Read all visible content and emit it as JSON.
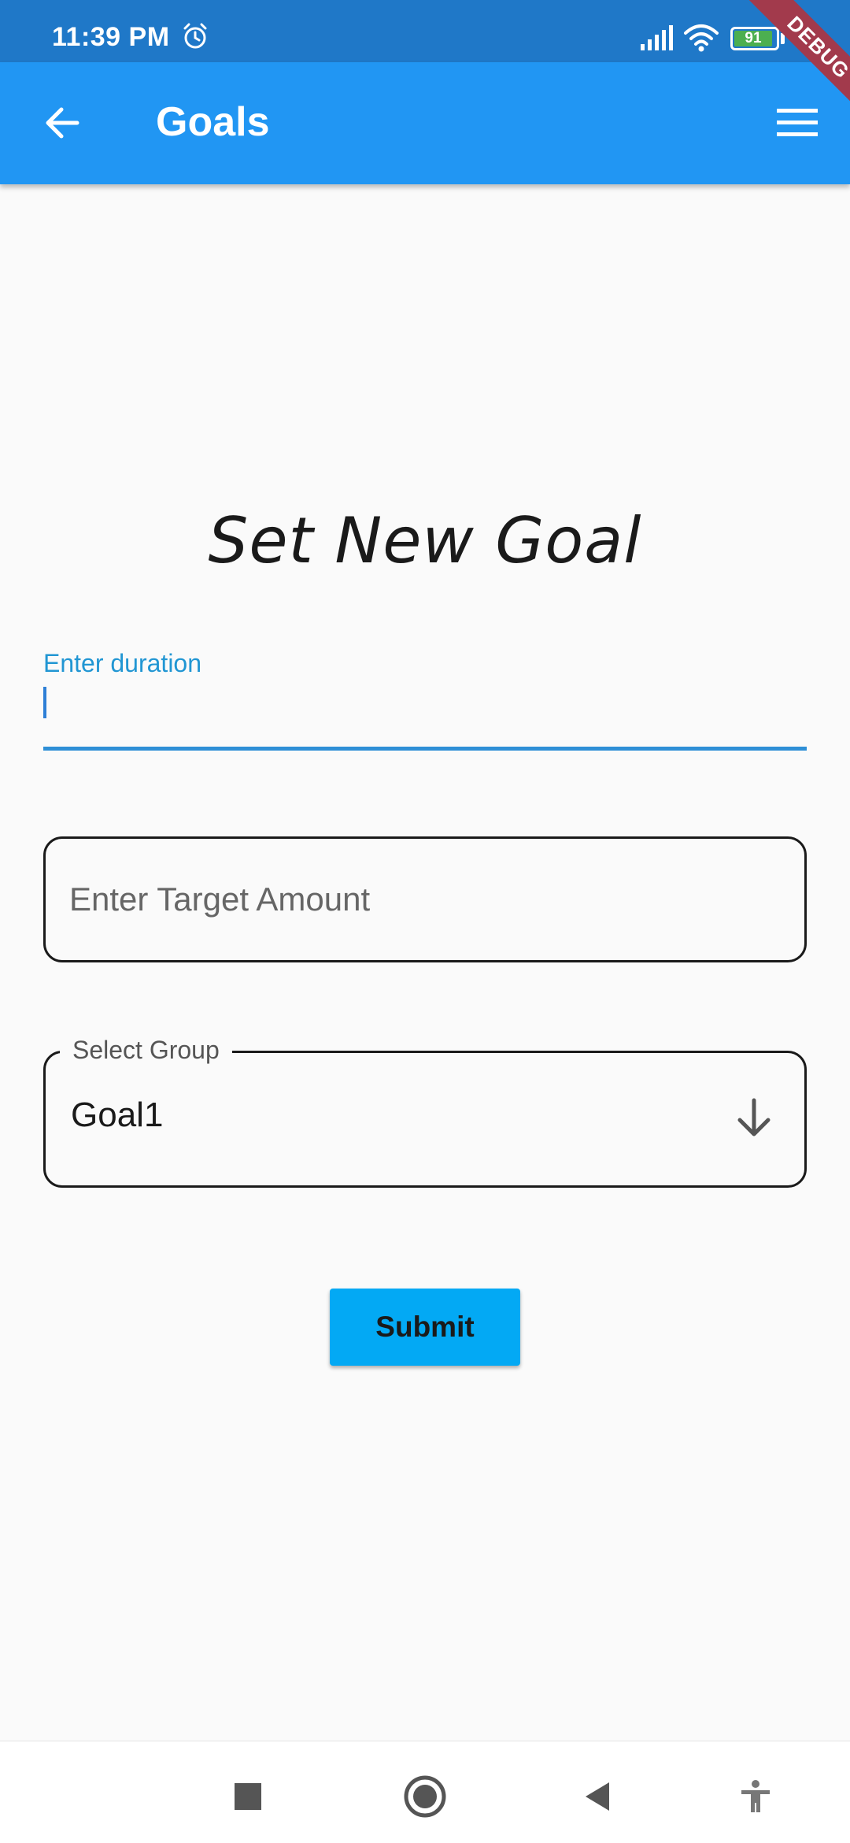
{
  "status_bar": {
    "time": "11:39 PM",
    "battery_level": "91",
    "icons": [
      "alarm-icon",
      "signal-icon",
      "wifi-icon",
      "battery-icon"
    ]
  },
  "debug_banner": "DEBUG",
  "app_bar": {
    "title": "Goals",
    "back_icon": "arrow-left-icon",
    "menu_icon": "hamburger-menu-icon",
    "color": "#2196f3"
  },
  "form": {
    "heading": "Set New Goal",
    "duration": {
      "label": "Enter duration",
      "value": ""
    },
    "target_amount": {
      "placeholder": "Enter Target Amount",
      "value": ""
    },
    "group": {
      "label": "Select Group",
      "selected": "Goal1",
      "icon": "arrow-down-icon"
    },
    "submit_label": "Submit",
    "submit_color": "#03a9f4"
  },
  "nav_bar": {
    "icons": [
      "recents-square-icon",
      "home-circle-icon",
      "back-triangle-icon",
      "accessibility-icon"
    ]
  }
}
